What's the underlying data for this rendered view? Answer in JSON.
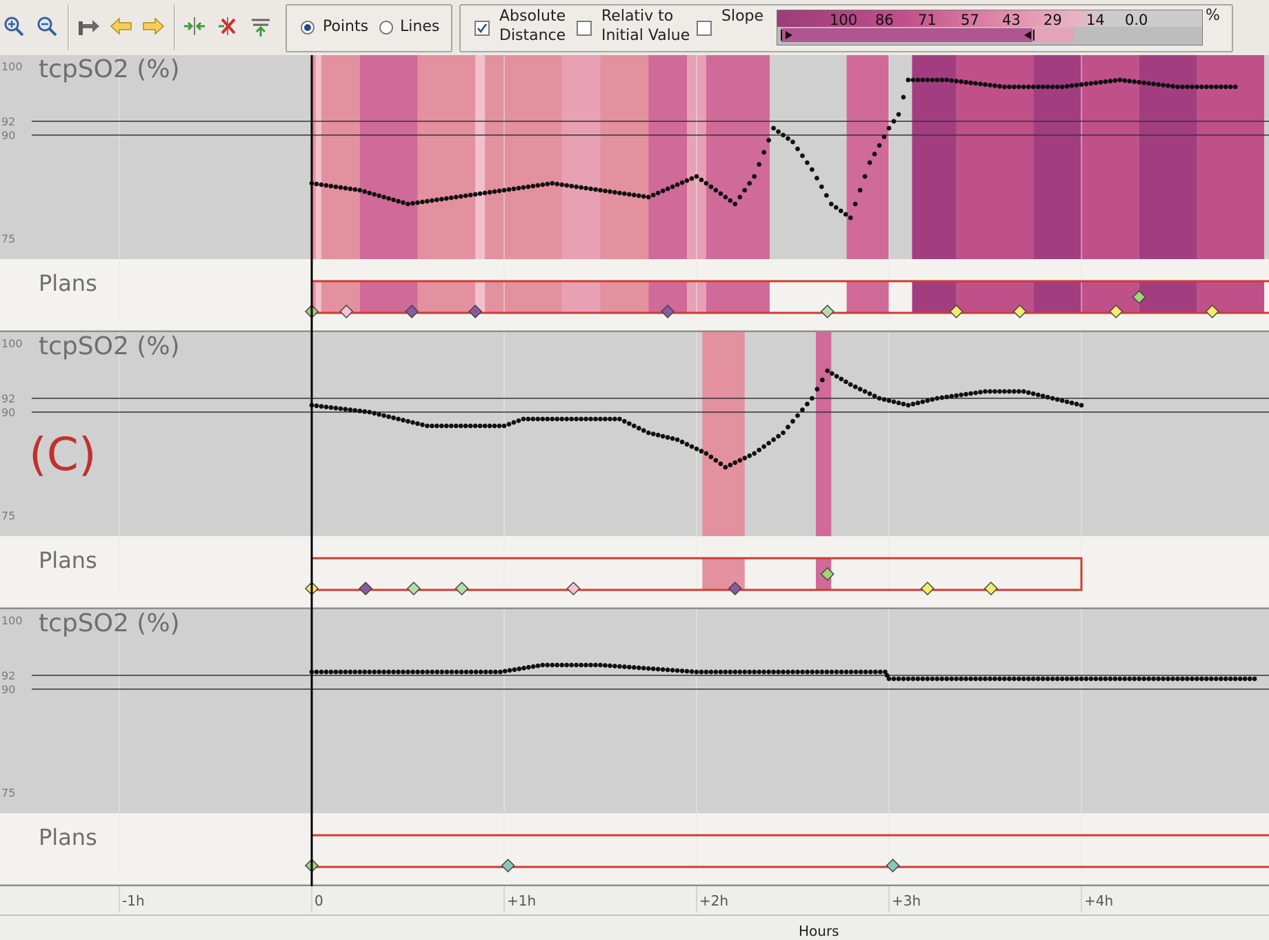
{
  "toolbar": {
    "icons": [
      "zoom-in-icon",
      "zoom-out-icon",
      "go-to-start-icon",
      "arrow-left-icon",
      "arrow-right-icon",
      "collapse-icon",
      "remove-icon",
      "align-icon"
    ],
    "display_mode": {
      "options": [
        "Points",
        "Lines"
      ],
      "selected": "Points"
    },
    "checkboxes": [
      {
        "line1": "Absolute",
        "line2": "Distance",
        "checked": true
      },
      {
        "line1": "Relativ to",
        "line2": "Initial Value",
        "checked": false
      },
      {
        "line1": "Slope",
        "line2": "",
        "checked": false
      }
    ],
    "legend_ticks": [
      "100",
      "86",
      "71",
      "57",
      "43",
      "29",
      "14",
      "0.0"
    ],
    "legend_unit": "%",
    "legend_colors": [
      "#9b3d7a",
      "#c0508a",
      "#d4739f",
      "#e28fad",
      "#e9b3c3",
      "#c8c8c8"
    ]
  },
  "panels": [
    {
      "title": "tcpSO2 (%)",
      "plans_label": "Plans",
      "tag": ""
    },
    {
      "title": "tcpSO2 (%)",
      "plans_label": "Plans",
      "tag": "(C)"
    },
    {
      "title": "tcpSO2 (%)",
      "plans_label": "Plans",
      "tag": ""
    }
  ],
  "y_ticks": [
    "100",
    "92",
    "90",
    "75"
  ],
  "x_ticks": [
    "-1h",
    "0",
    "+1h",
    "+2h",
    "+3h",
    "+4h"
  ],
  "x_axis_label": "Hours",
  "chart_data": [
    {
      "type": "scatter",
      "title": "tcpSO2 (%)",
      "ylim": [
        72,
        101
      ],
      "x": [
        0,
        0.25,
        0.5,
        0.75,
        1.0,
        1.25,
        1.5,
        1.75,
        2.0,
        2.2,
        2.3,
        2.4,
        2.5,
        2.6,
        2.7,
        2.8,
        2.9,
        3.0,
        3.05,
        3.1,
        3.3,
        3.6,
        3.9,
        4.2,
        4.5,
        4.8
      ],
      "y": [
        83,
        82,
        80,
        81,
        82,
        83,
        82,
        81,
        84,
        80,
        84,
        91,
        89,
        85,
        80,
        78,
        86,
        91,
        93,
        98,
        98,
        97,
        97,
        98,
        97,
        97
      ],
      "markers": [
        {
          "x": 0,
          "color": "#a6d27a"
        },
        {
          "x": 0.18,
          "color": "#f6c2cf"
        },
        {
          "x": 0.52,
          "color": "#8a5a9a"
        },
        {
          "x": 0.85,
          "color": "#8a5a9a"
        },
        {
          "x": 1.85,
          "color": "#8a5a9a"
        },
        {
          "x": 2.68,
          "color": "#b9dba8"
        },
        {
          "x": 3.35,
          "color": "#f3ec6a"
        },
        {
          "x": 3.68,
          "color": "#f3ec6a"
        },
        {
          "x": 4.18,
          "color": "#f3ec6a"
        },
        {
          "x": 4.68,
          "color": "#f3ec6a"
        }
      ]
    },
    {
      "type": "scatter",
      "title": "tcpSO2 (%)",
      "ylim": [
        72,
        101
      ],
      "x": [
        0,
        0.15,
        0.3,
        0.45,
        0.6,
        0.8,
        1.0,
        1.1,
        1.3,
        1.6,
        1.75,
        1.9,
        2.05,
        2.15,
        2.3,
        2.45,
        2.6,
        2.68,
        2.8,
        2.95,
        3.1,
        3.25,
        3.5,
        3.7,
        3.85,
        4.0
      ],
      "y": [
        91,
        90.5,
        90,
        89,
        88,
        88,
        88,
        89,
        89,
        89,
        87,
        86,
        84,
        82,
        84,
        87,
        92,
        96,
        94,
        92,
        91,
        92,
        93,
        93,
        92,
        91
      ],
      "markers": [
        {
          "x": 0,
          "color": "#f3ec6a"
        },
        {
          "x": 0.28,
          "color": "#8a5a9a"
        },
        {
          "x": 0.53,
          "color": "#b9dba8"
        },
        {
          "x": 0.78,
          "color": "#b9dba8"
        },
        {
          "x": 1.36,
          "color": "#f6c2cf"
        },
        {
          "x": 2.2,
          "color": "#8a5a9a"
        },
        {
          "x": 3.2,
          "color": "#f3ec6a"
        },
        {
          "x": 3.53,
          "color": "#f3ec6a"
        }
      ]
    },
    {
      "type": "scatter",
      "title": "tcpSO2 (%)",
      "ylim": [
        72,
        101
      ],
      "x": [
        0,
        0.5,
        0.98,
        1.2,
        1.5,
        2.0,
        2.5,
        2.98,
        3.0,
        3.5,
        4.0,
        4.5,
        4.9
      ],
      "y": [
        92.5,
        92.5,
        92.5,
        93.5,
        93.5,
        92.5,
        92.5,
        92.5,
        91.5,
        91.5,
        91.5,
        91.5,
        91.5
      ],
      "markers": [
        {
          "x": 0,
          "color": "#a6d27a"
        },
        {
          "x": 1.02,
          "color": "#8cc6b6"
        },
        {
          "x": 3.02,
          "color": "#8cc6b6"
        }
      ]
    }
  ]
}
